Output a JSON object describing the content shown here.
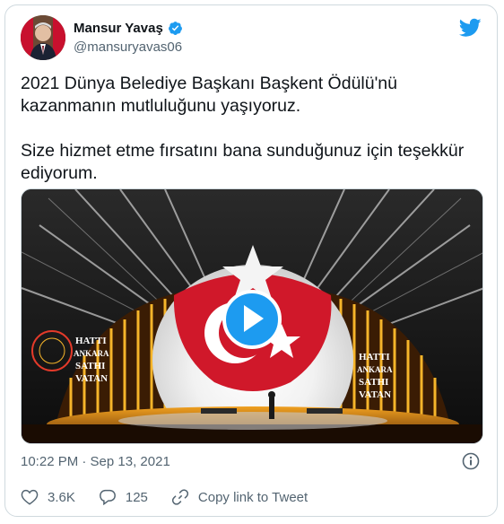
{
  "author": {
    "name": "Mansur Yavaş",
    "handle": "@mansuryavas06"
  },
  "tweet": {
    "paragraph1": "2021 Dünya Belediye Başkanı Başkent Ödülü'nü kazanmanın mutluluğunu yaşıyoruz.",
    "paragraph2": "Size hizmet etme fırsatını bana sunduğunuz için teşekkür ediyorum."
  },
  "media": {
    "banner_left": [
      "HATTI",
      "ANKARA",
      "SATHI",
      "VATAN"
    ],
    "banner_right": [
      "HATTI",
      "ANKARA",
      "SATHI",
      "VATAN"
    ]
  },
  "meta": {
    "timestamp": "10:22 PM · Sep 13, 2021"
  },
  "actions": {
    "likes": "3.6K",
    "replies": "125",
    "copy_link": "Copy link to Tweet"
  },
  "colors": {
    "accent": "#1d9bf0",
    "flag_red": "#d0182a",
    "secondary_text": "#536471"
  }
}
